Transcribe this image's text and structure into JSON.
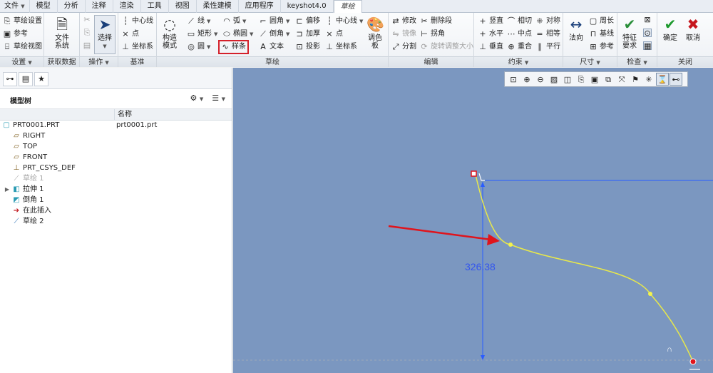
{
  "menu": {
    "tabs": [
      "文件",
      "模型",
      "分析",
      "注释",
      "渲染",
      "工具",
      "视图",
      "柔性建模",
      "应用程序",
      "keyshot4.0",
      "草绘"
    ],
    "active": "草绘"
  },
  "ribbon": {
    "setup": {
      "items": [
        "草绘设置",
        "参考",
        "草绘视图"
      ],
      "label": "设置"
    },
    "get_data": {
      "file_system": "文件\n系统",
      "label": "获取数据"
    },
    "operations": {
      "select": "选择",
      "label": "操作"
    },
    "datum": {
      "items": [
        "中心线",
        "点",
        "坐标系"
      ],
      "label": "基准"
    },
    "construction": {
      "label_btn": "构造\n模式"
    },
    "sketch": {
      "col1": [
        "线",
        "矩形",
        "圆"
      ],
      "col2": [
        "弧",
        "椭圆",
        "样条"
      ],
      "col3": [
        "圆角",
        "倒角",
        "文本"
      ],
      "col4": [
        "偏移",
        "加厚",
        "投影"
      ],
      "col5": [
        "中心线",
        "点",
        "坐标系"
      ],
      "palette": "调色\n板",
      "highlighted": "样条",
      "label": "草绘"
    },
    "edit": {
      "items": [
        "修改",
        "镜像",
        "分割"
      ],
      "items2": [
        "删除段",
        "拐角",
        "旋转调整大小"
      ],
      "label": "编辑"
    },
    "constrain": {
      "col1": [
        "竖直",
        "水平",
        "垂直"
      ],
      "col2": [
        "相切",
        "中点",
        "重合"
      ],
      "col3": [
        "对称",
        "相等",
        "平行"
      ],
      "label": "约束"
    },
    "dimension": {
      "normal": "法向",
      "items": [
        "周长",
        "基线",
        "参考"
      ],
      "label": "尺寸"
    },
    "inspect": {
      "feature_req": "特征\n要求",
      "label": "检查"
    },
    "close": {
      "ok": "确定",
      "cancel": "取消",
      "label": "关闭"
    }
  },
  "model_tree": {
    "title": "模型树",
    "col_name": "名称",
    "rows": [
      {
        "name": "PRT0001.PRT",
        "file": "prt0001.prt",
        "icon": "part-icon"
      },
      {
        "name": "RIGHT",
        "icon": "datum-plane-icon"
      },
      {
        "name": "TOP",
        "icon": "datum-plane-icon"
      },
      {
        "name": "FRONT",
        "icon": "datum-plane-icon"
      },
      {
        "name": "PRT_CSYS_DEF",
        "icon": "csys-icon"
      },
      {
        "name": "草绘 1",
        "icon": "sketch-icon",
        "dim": true
      },
      {
        "name": "拉伸 1",
        "icon": "extrude-icon",
        "expandable": true
      },
      {
        "name": "倒角 1",
        "icon": "chamfer-icon"
      },
      {
        "name": "在此插入",
        "icon": "insert-arrow-icon"
      },
      {
        "name": "草绘 2",
        "icon": "sketch-icon"
      }
    ]
  },
  "canvas": {
    "dimension_value": "326.38",
    "background": "#7b97c0",
    "spline_color": "#e8e84a",
    "arrow_color": "#e0141c"
  }
}
